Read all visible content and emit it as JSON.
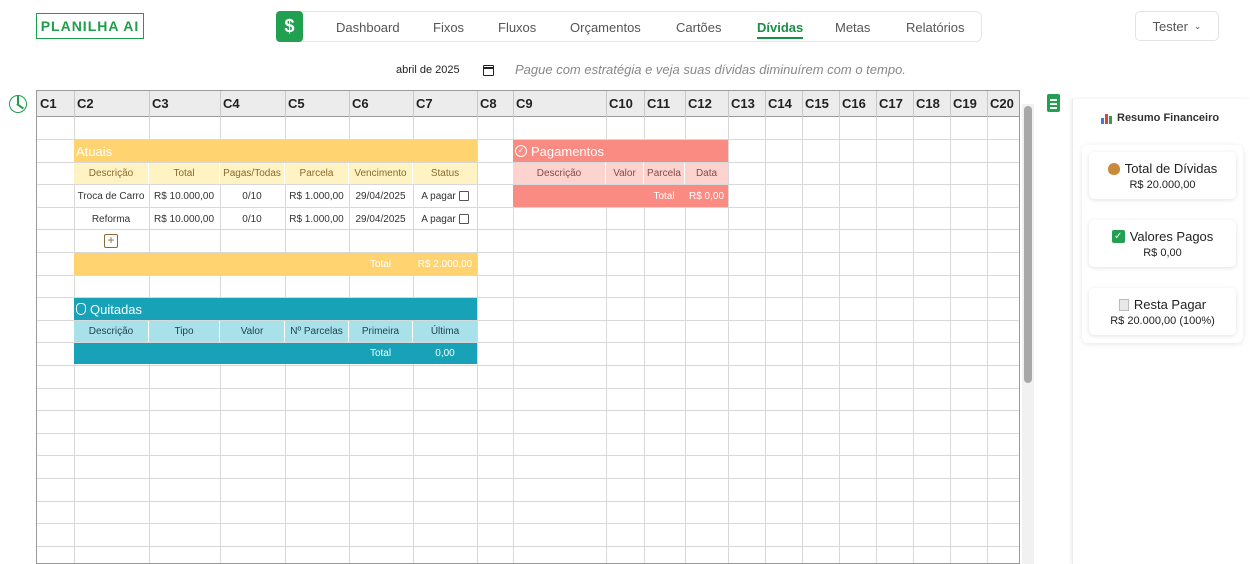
{
  "app": {
    "logo": "PLANILHA AI",
    "money_symbol": "$"
  },
  "nav": {
    "tabs": [
      {
        "label": "Dashboard"
      },
      {
        "label": "Fixos"
      },
      {
        "label": "Fluxos"
      },
      {
        "label": "Orçamentos"
      },
      {
        "label": "Cartões"
      },
      {
        "label": "Dívidas",
        "active": true
      },
      {
        "label": "Metas"
      },
      {
        "label": "Relatórios"
      }
    ]
  },
  "user": {
    "name": "Tester",
    "chevron": "chevron-down-icon"
  },
  "toolbar": {
    "month": "abril de 2025",
    "tagline": "Pague com estratégia e veja suas dívidas diminuírem com o tempo."
  },
  "sheet": {
    "columns": [
      "C1",
      "C2",
      "C3",
      "C4",
      "C5",
      "C6",
      "C7",
      "C8",
      "C9",
      "C10",
      "C11",
      "C12",
      "C13",
      "C14",
      "C15",
      "C16",
      "C17",
      "C18",
      "C19",
      "C20"
    ]
  },
  "atuais": {
    "title": "Atuais",
    "headers": [
      "Descrição",
      "Total",
      "Pagas/Todas",
      "Parcela",
      "Vencimento",
      "Status"
    ],
    "rows": [
      {
        "desc": "Troca de Carro",
        "total": "R$ 10.000,00",
        "pagas": "0/10",
        "parcela": "R$ 1.000,00",
        "venc": "29/04/2025",
        "status": "A pagar"
      },
      {
        "desc": "Reforma",
        "total": "R$ 10.000,00",
        "pagas": "0/10",
        "parcela": "R$ 1.000,00",
        "venc": "29/04/2025",
        "status": "A pagar"
      }
    ],
    "add": "+",
    "total_label": "Total",
    "total_value": "R$ 2.000,00"
  },
  "quitadas": {
    "title": "Quitadas",
    "headers": [
      "Descrição",
      "Tipo",
      "Valor",
      "Nº Parcelas",
      "Primeira",
      "Última"
    ],
    "total_label": "Total",
    "total_value": "0,00"
  },
  "pagamentos": {
    "title": "Pagamentos",
    "headers": [
      "Descrição",
      "Valor",
      "Parcela",
      "Data"
    ],
    "total_label": "Total",
    "total_value": "R$ 0,00"
  },
  "resumo": {
    "title": "Resumo Financeiro",
    "cards": [
      {
        "label": "Total de Dívidas",
        "value": "R$ 20.000,00",
        "icon": "money-bag-icon"
      },
      {
        "label": "Valores Pagos",
        "value": "R$ 0,00",
        "icon": "check-box-icon"
      },
      {
        "label": "Resta Pagar",
        "value": "R$ 20.000,00 (100%)",
        "icon": "page-icon"
      }
    ]
  },
  "colors": {
    "brand": "#1e9e4a",
    "atuais_header": "#ffd470",
    "atuais_sub": "#fff3c4",
    "quitadas_header": "#17a2b8",
    "quitadas_sub": "#a8e1ea",
    "pagamentos_header": "#f98b83",
    "pagamentos_sub": "#fcd3cf"
  }
}
